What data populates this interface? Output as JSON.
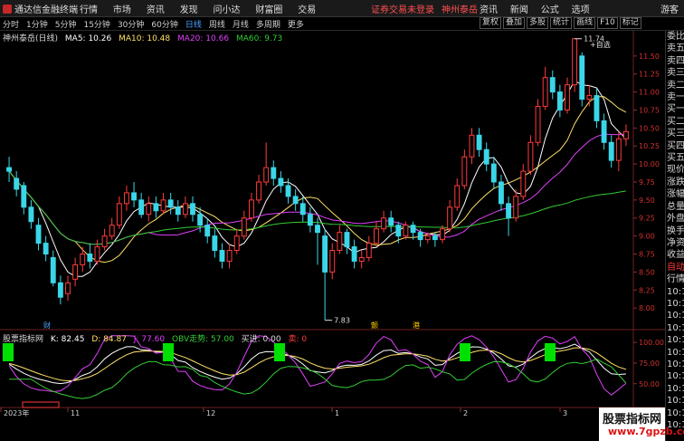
{
  "app": {
    "name": "通达信金融终端",
    "menu": [
      "行情",
      "市场",
      "资讯",
      "发现",
      "问小达",
      "财富圈",
      "交易"
    ]
  },
  "notice": {
    "text": "证券交易未登录",
    "stock": "神州泰岳"
  },
  "top_right": {
    "items": [
      "资讯",
      "新闻",
      "公式",
      "选项"
    ],
    "guest": "游客"
  },
  "periods": {
    "items": [
      "分时",
      "1分钟",
      "5分钟",
      "15分钟",
      "30分钟",
      "60分钟",
      "日线",
      "周线",
      "月线",
      "多周期",
      "更多"
    ],
    "active_index": 6
  },
  "tools": [
    "复权",
    "叠加",
    "多股",
    "统计",
    "画线",
    "F10",
    "标记"
  ],
  "main_legend": {
    "title": "神州泰岳(日线)",
    "ma": [
      {
        "label": "MA5: 10.26",
        "color": "#ffffff"
      },
      {
        "label": "MA10: 10.48",
        "color": "#ffe066"
      },
      {
        "label": "MA20: 10.66",
        "color": "#e040fb"
      },
      {
        "label": "MA60: 9.73",
        "color": "#33cc33"
      }
    ]
  },
  "price_axis": {
    "ticks": [
      "11.50",
      "11.25",
      "11.00",
      "10.75",
      "10.50",
      "10.25",
      "10.00",
      "9.75",
      "9.50",
      "9.25",
      "9.00",
      "8.75",
      "8.50",
      "8.25",
      "8.00"
    ]
  },
  "markers": {
    "high": "11.74",
    "low": "7.83",
    "self_select": "+自选",
    "events": [
      {
        "text": "财",
        "color": "#4aa3ff"
      },
      {
        "text": "颤",
        "color": "#ffcc00"
      },
      {
        "text": "港",
        "color": "#ffcc00"
      }
    ]
  },
  "sub_legend": {
    "title": "股票指标网",
    "items": [
      {
        "label": "K: 82.45",
        "color": "#ffffff"
      },
      {
        "label": "D: 84.87",
        "color": "#ffe066"
      },
      {
        "label": "J: 77.60",
        "color": "#e040fb"
      },
      {
        "label": "OBV走势: 57.00",
        "color": "#33cc33"
      },
      {
        "label": "买进: 0.00",
        "color": "#dddddd"
      },
      {
        "label": "卖: 0",
        "color": "#ff3b3b"
      }
    ]
  },
  "sub_axis": {
    "ticks": [
      "100.00",
      "75.00",
      "50.00"
    ]
  },
  "x_axis": {
    "labels": [
      "2023年",
      "11",
      "12",
      "1",
      "2",
      "3"
    ]
  },
  "sidebar": {
    "items": [
      {
        "text": "委比",
        "cls": ""
      },
      {
        "text": "卖五",
        "cls": ""
      },
      {
        "text": "卖四",
        "cls": ""
      },
      {
        "text": "卖三",
        "cls": ""
      },
      {
        "text": "卖二",
        "cls": ""
      },
      {
        "text": "卖一",
        "cls": ""
      },
      {
        "text": "买一",
        "cls": ""
      },
      {
        "text": "买二",
        "cls": ""
      },
      {
        "text": "买三",
        "cls": ""
      },
      {
        "text": "买四",
        "cls": ""
      },
      {
        "text": "买五",
        "cls": ""
      },
      {
        "text": "现价",
        "cls": ""
      },
      {
        "text": "涨跌",
        "cls": ""
      },
      {
        "text": "涨幅",
        "cls": ""
      },
      {
        "text": "总量",
        "cls": ""
      },
      {
        "text": "外盘",
        "cls": ""
      },
      {
        "text": "换手",
        "cls": ""
      },
      {
        "text": "净资",
        "cls": ""
      },
      {
        "text": "收益",
        "cls": ""
      },
      {
        "text": "自动",
        "cls": "red"
      },
      {
        "text": "行情",
        "cls": ""
      },
      {
        "text": "10:1",
        "cls": ""
      },
      {
        "text": "10:1",
        "cls": ""
      },
      {
        "text": "10:1",
        "cls": ""
      },
      {
        "text": "10:1",
        "cls": ""
      },
      {
        "text": "10:1",
        "cls": ""
      },
      {
        "text": "10:1",
        "cls": ""
      },
      {
        "text": "10:1",
        "cls": ""
      },
      {
        "text": "10:1",
        "cls": ""
      },
      {
        "text": "10:1",
        "cls": ""
      },
      {
        "text": "10:1",
        "cls": ""
      },
      {
        "text": "10:1",
        "cls": ""
      },
      {
        "text": "10:1",
        "cls": ""
      }
    ]
  },
  "watermark": {
    "line1": "股票指标网",
    "line2": "www.7gpzb.com"
  },
  "candles": [
    [
      9.95,
      9.9,
      10.1,
      9.75
    ],
    [
      9.8,
      9.65,
      9.9,
      9.55
    ],
    [
      9.7,
      9.4,
      9.75,
      9.3
    ],
    [
      9.4,
      9.2,
      9.5,
      9.1
    ],
    [
      9.15,
      8.9,
      9.25,
      8.8
    ],
    [
      8.9,
      8.75,
      9.0,
      8.65
    ],
    [
      8.7,
      8.35,
      8.8,
      8.3
    ],
    [
      8.35,
      8.15,
      8.45,
      8.05
    ],
    [
      8.2,
      8.35,
      8.45,
      8.1
    ],
    [
      8.4,
      8.6,
      8.7,
      8.3
    ],
    [
      8.6,
      8.75,
      8.85,
      8.5
    ],
    [
      8.75,
      8.65,
      8.9,
      8.55
    ],
    [
      8.65,
      8.85,
      8.95,
      8.6
    ],
    [
      8.85,
      9.0,
      9.1,
      8.8
    ],
    [
      9.0,
      9.15,
      9.25,
      8.95
    ],
    [
      9.15,
      9.45,
      9.55,
      9.1
    ],
    [
      9.45,
      9.6,
      9.7,
      9.35
    ],
    [
      9.6,
      9.5,
      9.75,
      9.4
    ],
    [
      9.5,
      9.3,
      9.6,
      9.25
    ],
    [
      9.3,
      9.45,
      9.55,
      9.2
    ],
    [
      9.45,
      9.35,
      9.55,
      9.25
    ],
    [
      9.35,
      9.5,
      9.6,
      9.3
    ],
    [
      9.5,
      9.4,
      9.6,
      9.3
    ],
    [
      9.4,
      9.3,
      9.5,
      9.2
    ],
    [
      9.3,
      9.45,
      9.55,
      9.25
    ],
    [
      9.45,
      9.3,
      9.55,
      9.2
    ],
    [
      9.3,
      9.15,
      9.4,
      9.05
    ],
    [
      9.15,
      9.0,
      9.25,
      8.9
    ],
    [
      9.0,
      8.8,
      9.1,
      8.7
    ],
    [
      8.8,
      8.65,
      8.9,
      8.55
    ],
    [
      8.65,
      8.8,
      8.9,
      8.55
    ],
    [
      8.8,
      9.0,
      9.1,
      8.75
    ],
    [
      9.0,
      9.25,
      9.35,
      8.95
    ],
    [
      9.25,
      9.5,
      9.6,
      9.2
    ],
    [
      9.5,
      9.75,
      9.85,
      9.45
    ],
    [
      9.75,
      9.95,
      10.3,
      9.7
    ],
    [
      9.95,
      9.8,
      10.05,
      9.7
    ],
    [
      9.8,
      9.7,
      9.9,
      9.6
    ],
    [
      9.7,
      9.55,
      9.8,
      9.45
    ],
    [
      9.55,
      9.45,
      9.65,
      9.35
    ],
    [
      9.45,
      9.3,
      9.55,
      9.2
    ],
    [
      9.3,
      9.15,
      9.4,
      9.05
    ],
    [
      9.15,
      9.05,
      9.25,
      8.6
    ],
    [
      9.0,
      8.5,
      9.1,
      7.83
    ],
    [
      8.5,
      8.8,
      8.9,
      8.4
    ],
    [
      8.8,
      9.05,
      9.15,
      8.75
    ],
    [
      9.05,
      8.85,
      9.1,
      8.75
    ],
    [
      8.85,
      8.65,
      8.95,
      8.55
    ],
    [
      8.65,
      8.7,
      8.8,
      8.55
    ],
    [
      8.7,
      8.9,
      9.0,
      8.65
    ],
    [
      8.9,
      9.1,
      9.2,
      8.85
    ],
    [
      9.1,
      9.25,
      9.35,
      9.05
    ],
    [
      9.25,
      9.15,
      9.35,
      9.05
    ],
    [
      9.15,
      9.0,
      9.2,
      8.9
    ],
    [
      9.0,
      9.15,
      9.2,
      8.95
    ],
    [
      9.15,
      9.05,
      9.2,
      8.95
    ],
    [
      9.05,
      8.95,
      9.1,
      8.85
    ],
    [
      8.95,
      9.0,
      9.05,
      8.9
    ],
    [
      9.0,
      8.95,
      9.05,
      8.85
    ],
    [
      8.95,
      9.1,
      9.15,
      8.9
    ],
    [
      9.1,
      9.4,
      9.5,
      9.05
    ],
    [
      9.4,
      9.7,
      9.8,
      9.35
    ],
    [
      9.7,
      10.1,
      10.2,
      9.65
    ],
    [
      10.1,
      10.4,
      10.5,
      10.0
    ],
    [
      10.4,
      10.2,
      10.5,
      10.1
    ],
    [
      10.2,
      10.0,
      10.3,
      9.9
    ],
    [
      10.0,
      9.75,
      10.1,
      9.65
    ],
    [
      9.75,
      9.45,
      9.85,
      9.35
    ],
    [
      9.45,
      9.25,
      9.55,
      9.0
    ],
    [
      9.25,
      9.55,
      9.65,
      9.2
    ],
    [
      9.55,
      9.9,
      10.0,
      9.5
    ],
    [
      9.9,
      10.3,
      10.4,
      9.85
    ],
    [
      10.3,
      10.8,
      10.9,
      10.25
    ],
    [
      10.8,
      11.2,
      11.35,
      10.75
    ],
    [
      11.2,
      11.0,
      11.3,
      10.9
    ],
    [
      11.0,
      10.75,
      11.1,
      10.65
    ],
    [
      10.75,
      11.1,
      11.2,
      10.7
    ],
    [
      11.1,
      11.74,
      11.74,
      11.0
    ],
    [
      11.5,
      10.9,
      11.55,
      10.8
    ],
    [
      10.9,
      10.95,
      11.1,
      10.8
    ],
    [
      10.95,
      10.6,
      11.05,
      10.5
    ],
    [
      10.6,
      10.3,
      10.7,
      10.2
    ],
    [
      10.3,
      10.05,
      10.4,
      9.95
    ],
    [
      10.05,
      10.35,
      10.45,
      9.9
    ],
    [
      10.35,
      10.45,
      10.55,
      10.25
    ]
  ]
}
